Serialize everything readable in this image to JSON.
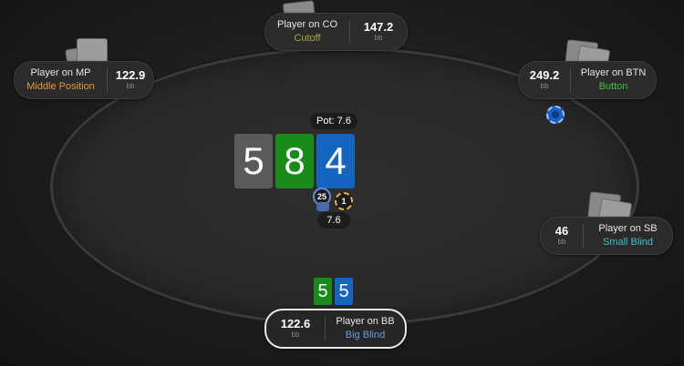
{
  "pot": {
    "label": "Pot: 7.6"
  },
  "board": [
    {
      "rank": "5",
      "color": "#5a5a5a"
    },
    {
      "rank": "8",
      "color": "#1a8a1a"
    },
    {
      "rank": "4",
      "color": "#1565c0"
    }
  ],
  "hero_cards": [
    {
      "rank": "5",
      "color": "#1a8a1a"
    },
    {
      "rank": "5",
      "color": "#1565c0"
    }
  ],
  "bet": {
    "amount": "7.6",
    "chip_25": "25",
    "chip_1": "1"
  },
  "seats": {
    "co": {
      "stack": "147.2",
      "unit": "bb",
      "name": "Player on CO",
      "position": "Cutoff",
      "position_color": "#a8a83a"
    },
    "mp": {
      "stack": "122.9",
      "unit": "bb",
      "name": "Player on MP",
      "position": "Middle Position",
      "position_color": "#e0963a"
    },
    "btn": {
      "stack": "249.2",
      "unit": "bb",
      "name": "Player on BTN",
      "position": "Button",
      "position_color": "#3ac43a"
    },
    "sb": {
      "stack": "46",
      "unit": "bb",
      "name": "Player on SB",
      "position": "Small Blind",
      "position_color": "#3ac4c4"
    },
    "bb": {
      "stack": "122.6",
      "unit": "bb",
      "name": "Player on BB",
      "position": "Big Blind",
      "position_color": "#6a9ae0"
    }
  },
  "colors": {
    "table_felt": "#282828",
    "background": "#1c1c1c",
    "dealer_button": "#1e5fc4"
  }
}
